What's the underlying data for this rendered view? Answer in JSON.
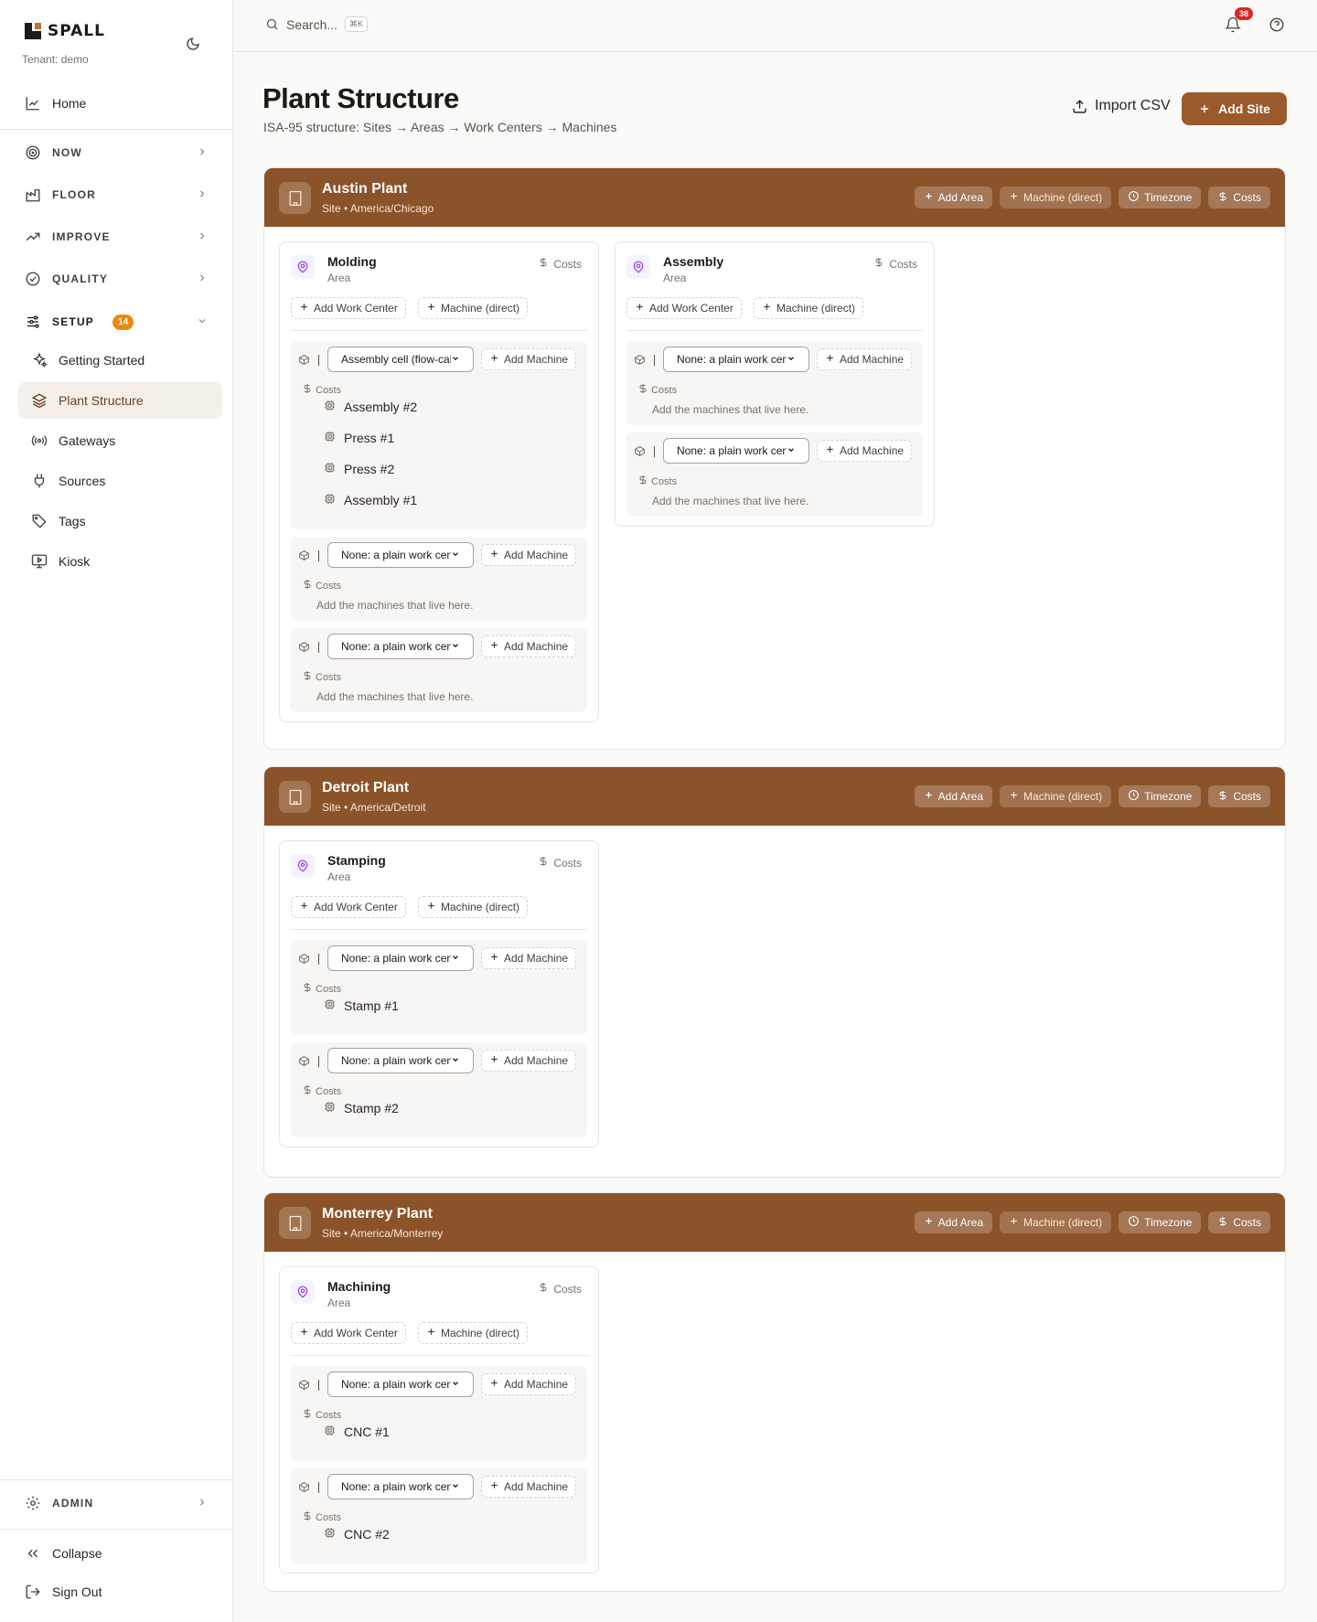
{
  "brand": {
    "name": "SPALL",
    "tenant": "Tenant: demo"
  },
  "nav": {
    "home": "Home",
    "now": "NOW",
    "floor": "FLOOR",
    "improve": "IMPROVE",
    "quality": "QUALITY",
    "setup": "SETUP",
    "setup_count": "14",
    "setup_items": [
      "Getting Started",
      "Plant Structure",
      "Gateways",
      "Sources",
      "Tags",
      "Kiosk"
    ],
    "admin": "ADMIN",
    "collapse": "Collapse",
    "sign_out": "Sign Out"
  },
  "topbar": {
    "search_placeholder": "Search...",
    "shortcut": "⌘K",
    "notifications": "38"
  },
  "page": {
    "title": "Plant Structure",
    "subtitle": "ISA-95 structure: Sites → Areas → Work Centers → Machines",
    "import_label": "Import CSV",
    "add_site_label": "Add Site"
  },
  "labels": {
    "add_area": "Add Area",
    "machine_direct": "Machine (direct)",
    "timezone": "Timezone",
    "costs": "Costs",
    "area": "Area",
    "add_work_center": "Add Work Center",
    "add_machine": "Add Machine",
    "empty_machines": "Add the machines that live here."
  },
  "sites": [
    {
      "name": "Austin Plant",
      "meta": "Site • America/Chicago",
      "areas": [
        {
          "name": "Molding",
          "work_centers": [
            {
              "type": "Assembly cell (flow-cal",
              "machines": [
                "Assembly #2",
                "Press #1",
                "Press #2",
                "Assembly #1"
              ]
            },
            {
              "type": "None: a plain work cen",
              "machines": []
            },
            {
              "type": "None: a plain work cen",
              "machines": []
            }
          ]
        },
        {
          "name": "Assembly",
          "work_centers": [
            {
              "type": "None: a plain work cen",
              "machines": []
            },
            {
              "type": "None: a plain work cen",
              "machines": []
            }
          ]
        }
      ]
    },
    {
      "name": "Detroit Plant",
      "meta": "Site • America/Detroit",
      "areas": [
        {
          "name": "Stamping",
          "work_centers": [
            {
              "type": "None: a plain work cen",
              "machines": [
                "Stamp #1"
              ]
            },
            {
              "type": "None: a plain work cen",
              "machines": [
                "Stamp #2"
              ]
            }
          ]
        }
      ]
    },
    {
      "name": "Monterrey Plant",
      "meta": "Site • America/Monterrey",
      "areas": [
        {
          "name": "Machining",
          "work_centers": [
            {
              "type": "None: a plain work cen",
              "machines": [
                "CNC #1"
              ]
            },
            {
              "type": "None: a plain work cen",
              "machines": [
                "CNC #2"
              ]
            }
          ]
        }
      ]
    }
  ],
  "colors": {
    "accent": "#9a5a2c",
    "site_header": "#8b5329",
    "badge": "#ea8a0c",
    "notif": "#dc2626"
  }
}
